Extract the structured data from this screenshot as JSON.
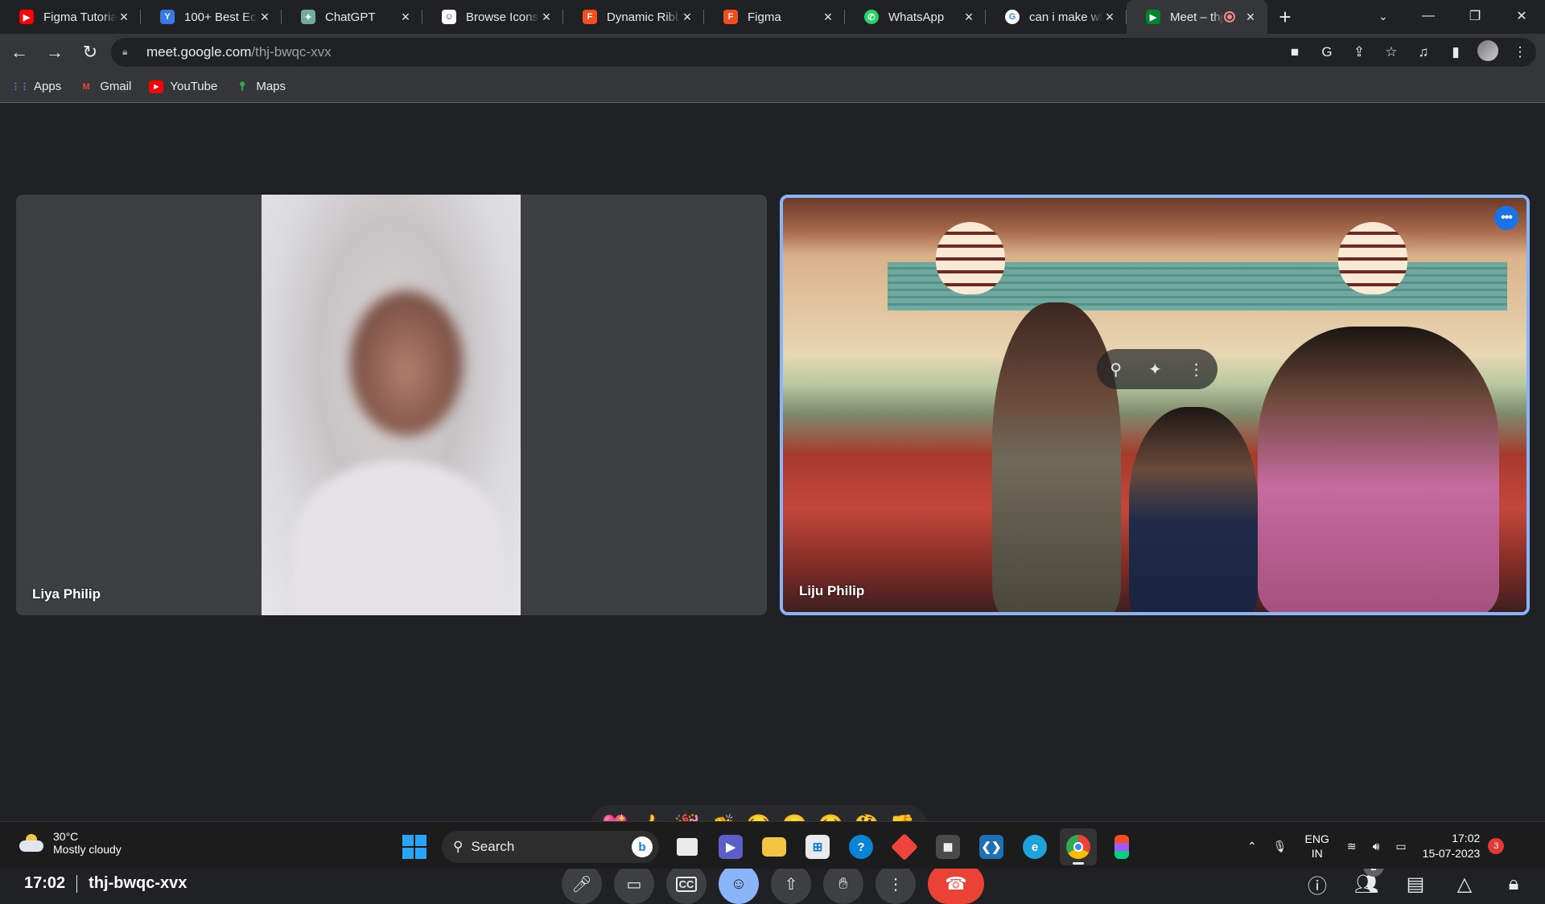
{
  "browser": {
    "tabs": [
      {
        "title": "Figma Tutorial",
        "fav_color": "#ff0000",
        "fav_glyph": "▶"
      },
      {
        "title": "100+ Best Eco",
        "fav_color": "#3b78e7",
        "fav_glyph": "Y"
      },
      {
        "title": "ChatGPT",
        "fav_color": "#74aa9c",
        "fav_glyph": "✦"
      },
      {
        "title": "Browse Icons -",
        "fav_color": "#ffffff",
        "fav_glyph": "☺"
      },
      {
        "title": "Dynamic Ribb",
        "fav_color": "#f24e1e",
        "fav_glyph": "F"
      },
      {
        "title": "Figma",
        "fav_color": "#f24e1e",
        "fav_glyph": "F"
      },
      {
        "title": "WhatsApp",
        "fav_color": "#25d366",
        "fav_glyph": "✆"
      },
      {
        "title": "can i make wh",
        "fav_color": "#4285f4",
        "fav_glyph": "G"
      },
      {
        "title": "Meet – thj",
        "fav_color": "#00832d",
        "fav_glyph": "▶"
      }
    ],
    "url_host": "meet.google.com",
    "url_path": "/thj-bwqc-xvx",
    "bookmarks": [
      {
        "label": "Apps",
        "icon": "apps-grid-icon"
      },
      {
        "label": "Gmail",
        "icon": "gmail-icon"
      },
      {
        "label": "YouTube",
        "icon": "youtube-icon"
      },
      {
        "label": "Maps",
        "icon": "maps-icon"
      }
    ]
  },
  "meet": {
    "participants": [
      {
        "name": "Liya Philip"
      },
      {
        "name": "Liju Philip"
      }
    ],
    "reactions": [
      "💖",
      "👍",
      "🎉",
      "👏",
      "😂",
      "😮",
      "😢",
      "🤔",
      "👎"
    ],
    "time": "17:02",
    "meeting_code": "thj-bwqc-xvx",
    "people_count": "2",
    "colors": {
      "accent": "#8ab4f8",
      "end_call": "#ea4335",
      "more_button": "#1a73e8"
    }
  },
  "taskbar": {
    "weather_temp": "30°C",
    "weather_desc": "Mostly cloudy",
    "search_placeholder": "Search",
    "lang_top": "ENG",
    "lang_bottom": "IN",
    "time": "17:02",
    "date": "15-07-2023",
    "notification_count": "3"
  }
}
